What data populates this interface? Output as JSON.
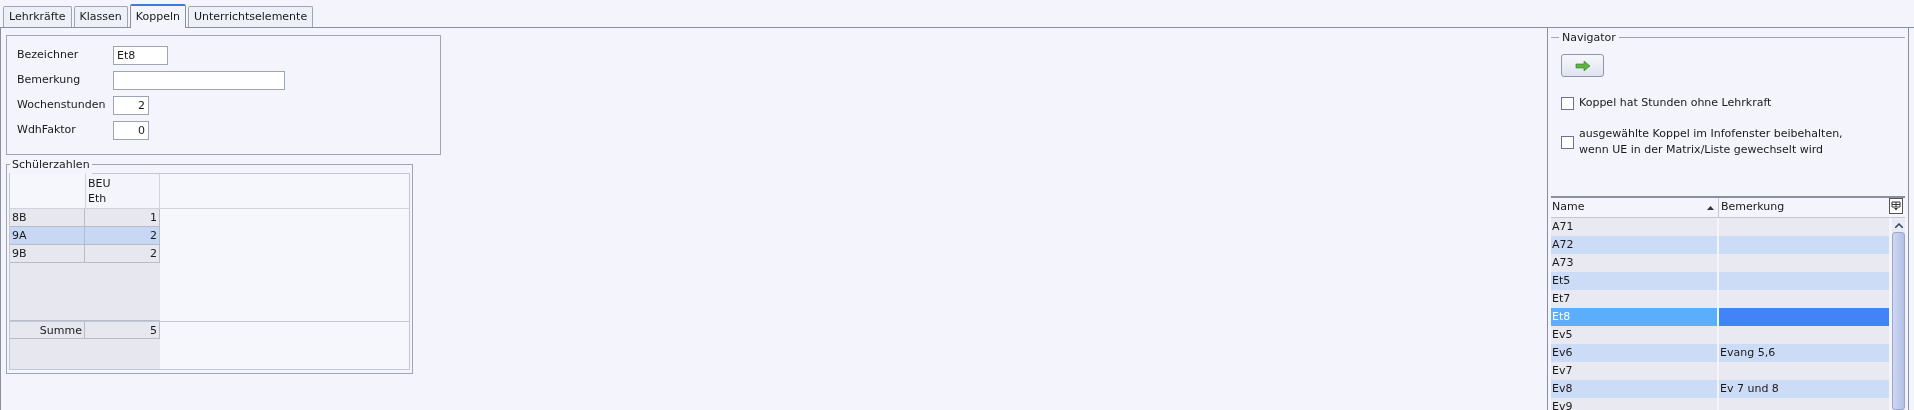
{
  "tabs": [
    {
      "label": "Lehrkräfte",
      "selected": false
    },
    {
      "label": "Klassen",
      "selected": false
    },
    {
      "label": "Koppeln",
      "selected": true
    },
    {
      "label": "Unterrichtselemente",
      "selected": false
    }
  ],
  "form": {
    "fields": [
      {
        "label": "Bezeichner",
        "value": "Et8",
        "kind": "text"
      },
      {
        "label": "Bemerkung",
        "kind": "text"
      },
      {
        "label": "Wochenstunden",
        "value": "2",
        "kind": "number"
      },
      {
        "label": "WdhFaktor",
        "value": "0",
        "kind": "number"
      }
    ]
  },
  "student_counts": {
    "title": "Schülerzahlen",
    "column_header": [
      "BEU",
      "Eth"
    ],
    "rows": [
      {
        "label": "8B",
        "value": "1",
        "selected": false
      },
      {
        "label": "9A",
        "value": "2",
        "selected": true
      },
      {
        "label": "9B",
        "value": "2",
        "selected": false
      }
    ],
    "total": {
      "label": "Summe",
      "value": "5"
    }
  },
  "navigator": {
    "title": "Navigator",
    "checkboxes": [
      {
        "label": "Koppel hat Stunden ohne Lehrkraft",
        "checked": false
      },
      {
        "label": "ausgewählte Koppel im Infofenster beibehalten,\nwenn UE in der Matrix/Liste gewechselt wird",
        "checked": false
      }
    ],
    "table": {
      "columns": [
        "Name",
        "Bemerkung"
      ],
      "rows": [
        {
          "name": "A71",
          "selected": false
        },
        {
          "name": "A72",
          "selected": false
        },
        {
          "name": "A73",
          "selected": false
        },
        {
          "name": "Et5",
          "selected": false
        },
        {
          "name": "Et7",
          "selected": false
        },
        {
          "name": "Et8",
          "selected": true
        },
        {
          "name": "Ev5",
          "selected": false
        },
        {
          "name": "Ev6",
          "remark": "Evang 5,6",
          "selected": false
        },
        {
          "name": "Ev7",
          "selected": false
        },
        {
          "name": "Ev8",
          "remark": "Ev 7 und 8",
          "selected": false
        },
        {
          "name": "Ev9",
          "selected": false
        }
      ]
    }
  }
}
